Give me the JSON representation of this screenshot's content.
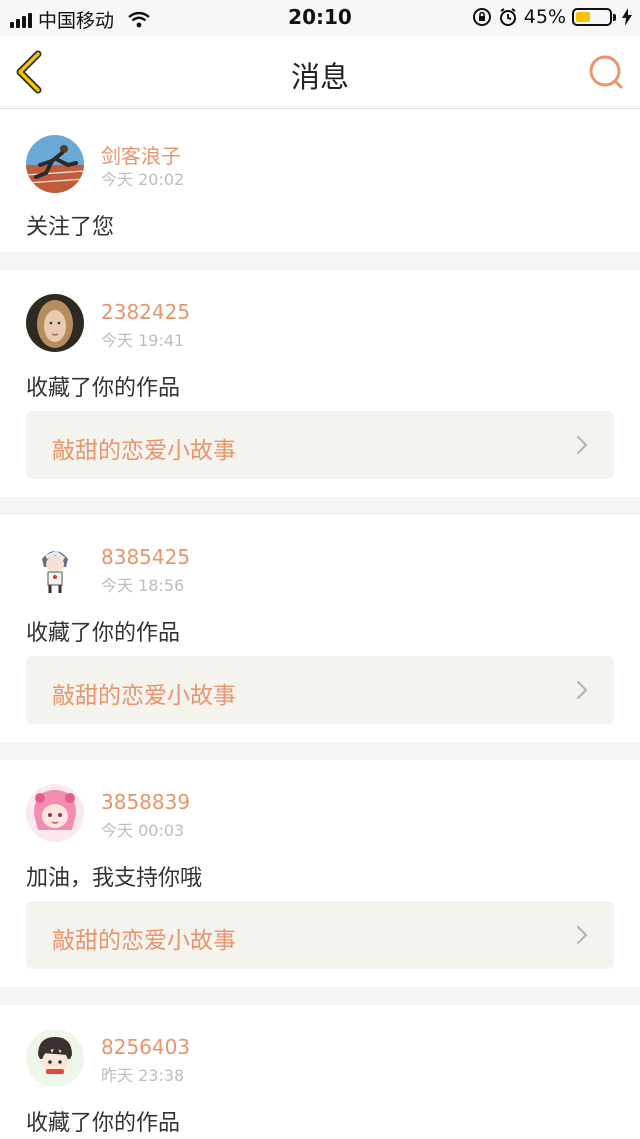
{
  "status_bar": {
    "carrier": "中国移动",
    "time": "20:10",
    "battery_percent_label": "45%",
    "battery_level": 0.45,
    "battery_color": "#f5c400",
    "icons": [
      "signal-icon",
      "wifi-icon",
      "rotation-lock-icon",
      "alarm-icon",
      "charging-icon"
    ]
  },
  "nav": {
    "title": "消息",
    "back_icon": "chevron-left-icon",
    "search_icon": "search-icon",
    "accent_color": "#e9946a"
  },
  "messages": [
    {
      "username": "剑客浪子",
      "time": "今天 20:02",
      "text": "关注了您",
      "work_title": null,
      "avatar": "runner-avatar"
    },
    {
      "username": "2382425",
      "time": "今天 19:41",
      "text": "收藏了你的作品",
      "work_title": "敲甜的恋爱小故事",
      "avatar": "woman-portrait-avatar"
    },
    {
      "username": "8385425",
      "time": "今天 18:56",
      "text": "收藏了你的作品",
      "work_title": "敲甜的恋爱小故事",
      "avatar": "anime-boy-avatar"
    },
    {
      "username": "3858839",
      "time": "今天 00:03",
      "text": "加油，我支持你哦",
      "work_title": "敲甜的恋爱小故事",
      "avatar": "anime-pink-girl-avatar"
    },
    {
      "username": "8256403",
      "time": "昨天 23:38",
      "text": "收藏了你的作品",
      "work_title": null,
      "avatar": "anime-boy-avatar-2"
    }
  ]
}
